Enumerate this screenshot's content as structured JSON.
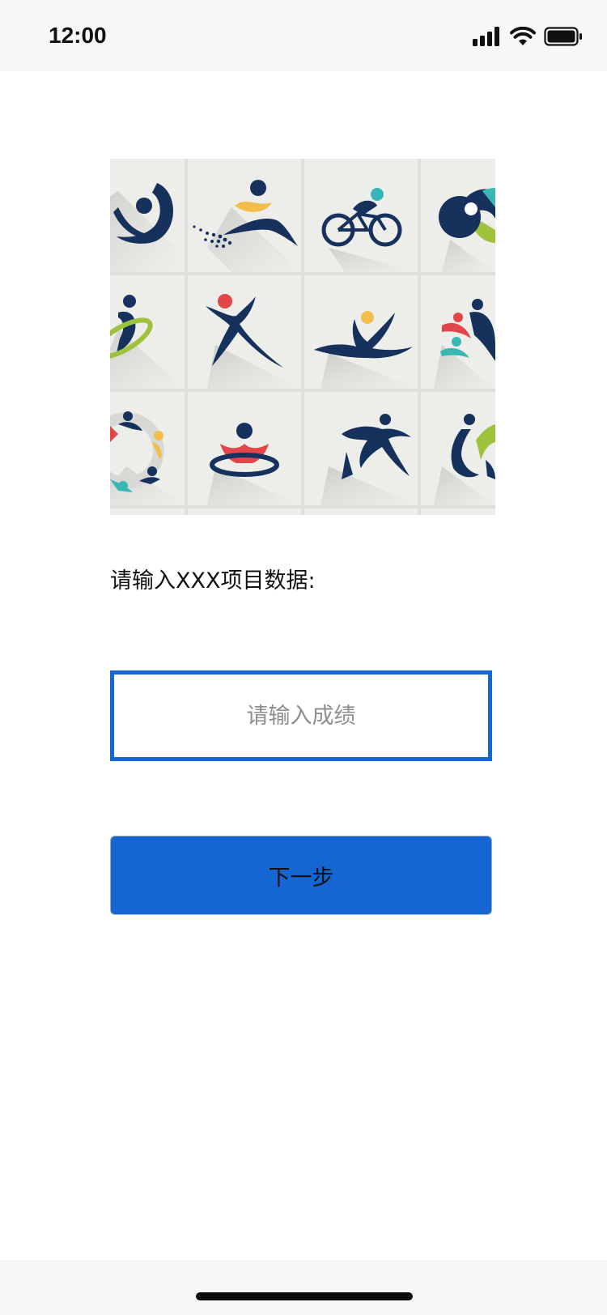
{
  "status_bar": {
    "time": "12:00",
    "icons": [
      "cellular-signal-icon",
      "wifi-icon",
      "battery-icon"
    ]
  },
  "hero_image": {
    "icons": [
      "yoga-pose-icon",
      "swimming-icon",
      "cycling-icon",
      "fitness-circle-icon",
      "hoop-dance-icon",
      "running-leap-icon",
      "ballet-leap-icon",
      "group-fitness-icon",
      "team-ring-icon",
      "pool-swimmer-icon",
      "gymnast-run-icon",
      "stretching-icon"
    ]
  },
  "prompt": {
    "label": "请输入XXX项目数据:"
  },
  "score_input": {
    "value": "",
    "placeholder": "请输入成绩"
  },
  "next_button": {
    "label": "下一步"
  },
  "colors": {
    "accent": "#1565d3",
    "status_bar_bg": "#f7f7f7",
    "tile_bg": "#edeeea",
    "navy": "#16325c",
    "yellow": "#f2bd4a",
    "teal": "#3ab7b5",
    "red": "#e2464a",
    "green": "#9ec23c"
  }
}
